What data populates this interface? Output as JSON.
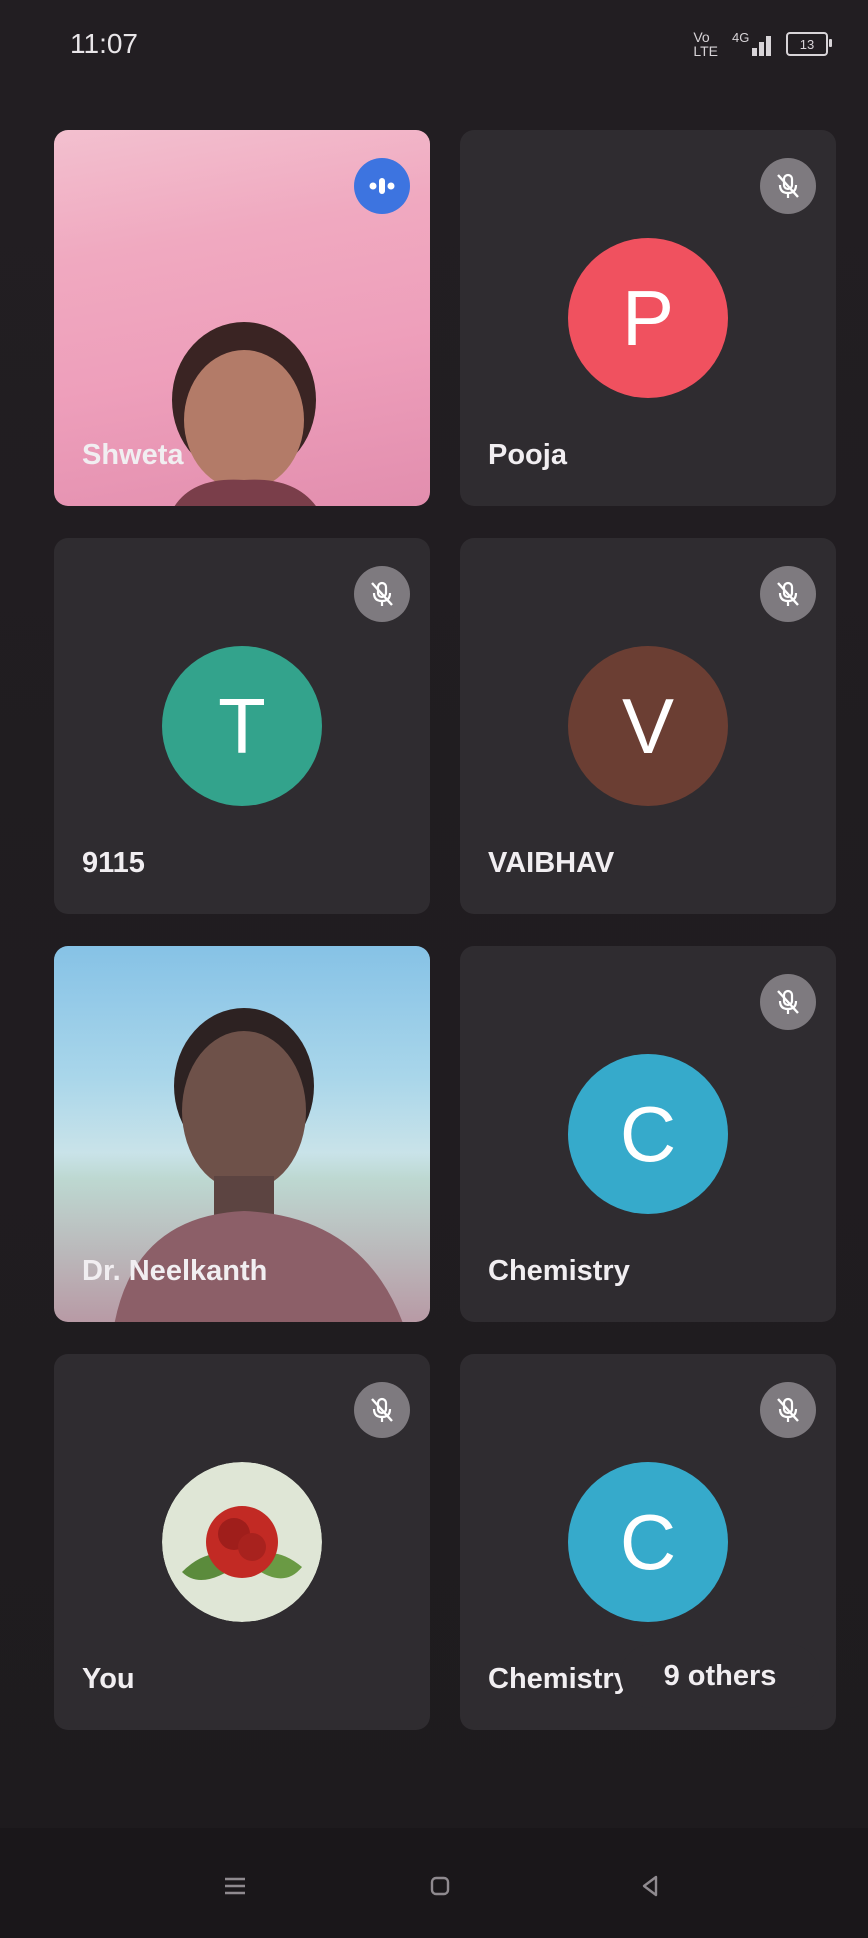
{
  "status_bar": {
    "time": "11:07",
    "battery": "13",
    "network_label": "4G"
  },
  "participants": [
    {
      "name": "Shweta",
      "type": "video",
      "state": "speaking"
    },
    {
      "name": "Pooja",
      "type": "avatar",
      "initial": "P",
      "color": "#f0515f",
      "state": "muted"
    },
    {
      "name": "9115",
      "type": "avatar",
      "initial": "T",
      "color": "#33a38c",
      "state": "muted"
    },
    {
      "name": "VAIBHAV",
      "type": "avatar",
      "initial": "V",
      "color": "#6b3e33",
      "state": "muted"
    },
    {
      "name": "Dr. Neelkanth",
      "type": "video",
      "state": "unmuted"
    },
    {
      "name": "Chemistry",
      "type": "avatar",
      "initial": "C",
      "color": "#36aacb",
      "state": "muted"
    },
    {
      "name": "You",
      "type": "image-avatar",
      "image": "rose-avatar",
      "state": "muted"
    },
    {
      "name": "Chemistry",
      "type": "avatar",
      "initial": "C",
      "color": "#36aacb",
      "state": "muted"
    }
  ],
  "others_label": "9 others",
  "nav": {
    "items": [
      "menu-icon",
      "home-icon",
      "back-icon"
    ]
  }
}
